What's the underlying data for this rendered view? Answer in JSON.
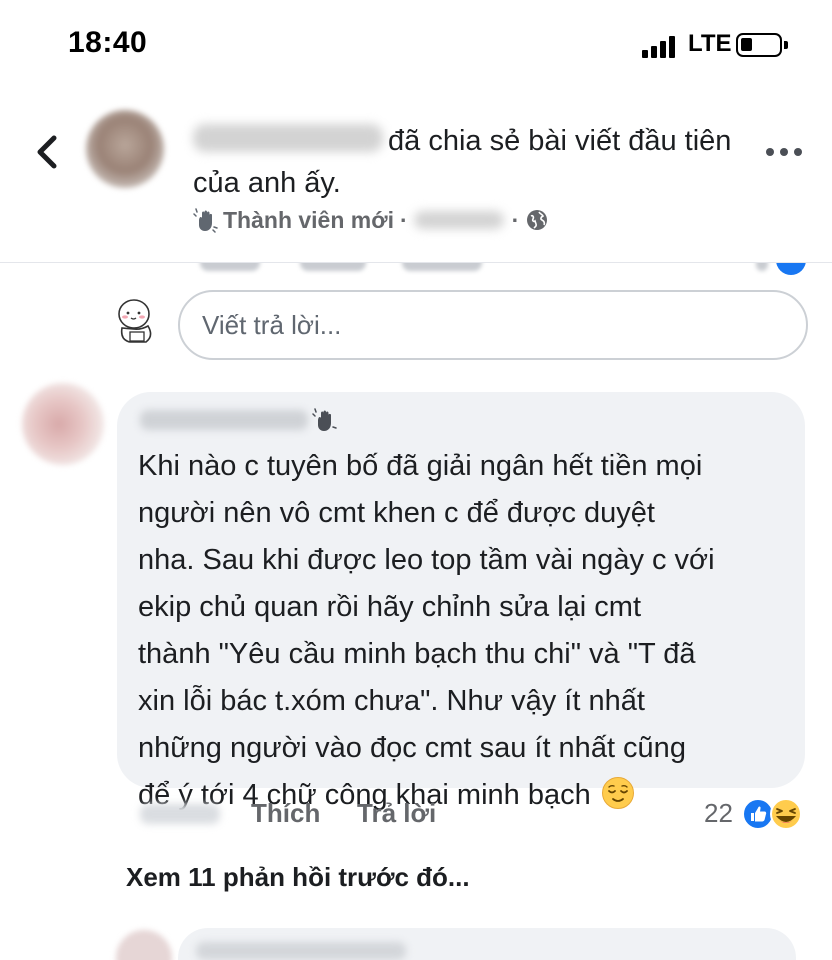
{
  "status_bar": {
    "time": "18:40",
    "network": "LTE",
    "battery_level": 0.3
  },
  "header": {
    "back_icon": "chevron-left-icon",
    "action_text": "đã chia sẻ bài viết đầu tiên của anh ấy.",
    "badge_label": "Thành viên mới",
    "separator": "·",
    "privacy_icon": "globe-icon",
    "more_icon": "more-horizontal-icon"
  },
  "reply_box": {
    "placeholder": "Viết trả lời..."
  },
  "comment": {
    "text": "Khi nào c tuyên bố đã giải ngân hết tiền mọi\nngười nên vô cmt khen c để được duyệt\nnha. Sau khi được leo top tầm vài ngày c với\nekip chủ quan rồi hãy chỉnh sửa lại cmt\nthành \"Yêu cầu minh bạch thu chi\" và \"T đã\nxin lỗi bác t.xóm chưa\". Như vậy ít nhất\nnhững người vào đọc cmt sau ít nhất cũng\nđể ý tới 4 chữ công khai minh bạch",
    "emoji": "relieved-face-icon",
    "like_label": "Thích",
    "reply_label": "Trả lời",
    "reaction_count": "22",
    "reaction_icons": [
      "like-reaction-icon",
      "haha-reaction-icon"
    ]
  },
  "more_replies": {
    "label": "Xem 11 phản hồi trước đó..."
  },
  "colors": {
    "facebook_blue": "#1877f2",
    "secondary_text": "#65676b",
    "bubble_bg": "#f0f2f5"
  }
}
